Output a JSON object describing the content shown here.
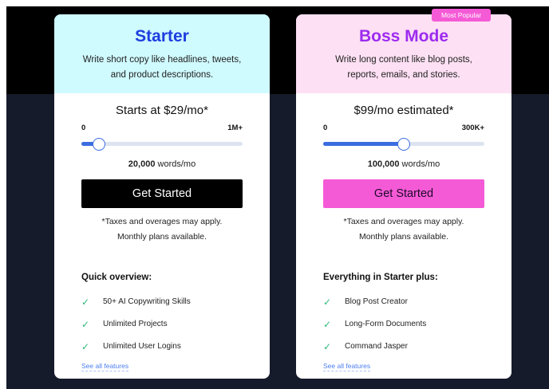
{
  "plans": {
    "starter": {
      "name": "Starter",
      "description": "Write short copy like headlines, tweets, and product descriptions.",
      "price": "Starts at $29/mo*",
      "slider": {
        "min_label": "0",
        "max_label": "1M+",
        "value_fraction": 0.11
      },
      "words_value": "20,000",
      "words_unit": " words/mo",
      "cta_label": "Get Started",
      "note_line1": "*Taxes and overages may apply.",
      "note_line2": "Monthly plans available.",
      "features_title": "Quick overview:",
      "features": [
        {
          "label": "50+ AI Copywriting Skills",
          "icon": "check-icon"
        },
        {
          "label": "Unlimited Projects",
          "icon": "check-icon"
        },
        {
          "label": "Unlimited User Logins",
          "icon": "check-icon"
        }
      ],
      "see_all": "See all features",
      "accent": "#1d3ee0",
      "header_bg": "#cffafe",
      "cta_bg": "#000000"
    },
    "boss": {
      "badge": "Most Popular",
      "name": "Boss Mode",
      "description": "Write long content like blog posts, reports, emails, and stories.",
      "price": "$99/mo estimated*",
      "slider": {
        "min_label": "0",
        "max_label": "300K+",
        "value_fraction": 0.5
      },
      "words_value": "100,000",
      "words_unit": " words/mo",
      "cta_label": "Get Started",
      "note_line1": "*Taxes and overages may apply.",
      "note_line2": "Monthly plans available.",
      "features_title": "Everything in Starter plus:",
      "features": [
        {
          "label": "Blog Post Creator",
          "icon": "check-icon"
        },
        {
          "label": "Long-Form Documents",
          "icon": "check-icon"
        },
        {
          "label": "Command Jasper",
          "icon": "check-icon"
        }
      ],
      "see_all": "See all features",
      "accent": "#9d2bf0",
      "header_bg": "#fde0f3",
      "cta_bg": "#f55ad6"
    }
  },
  "colors": {
    "check": "#2fb979",
    "slider_fill": "#3b6ce0",
    "slider_track": "#dde4f0",
    "background_dark": "#151b2b"
  }
}
